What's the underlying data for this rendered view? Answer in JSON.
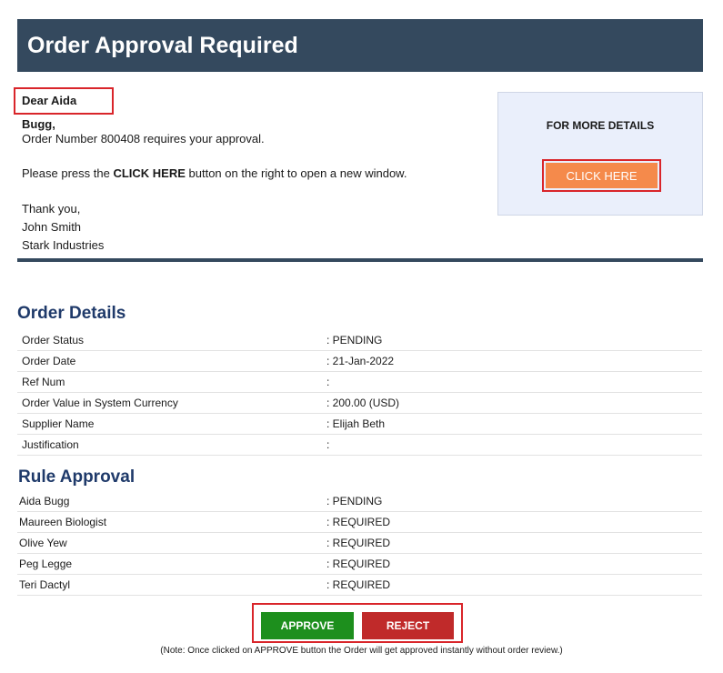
{
  "header": {
    "title": "Order Approval Required"
  },
  "greeting": "Dear Aida Bugg,",
  "intro": {
    "approval_line": "Order Number 800408 requires your approval.",
    "press_prefix": "Please press the ",
    "press_bold": "CLICK HERE",
    "press_suffix": " button on the right to open a new window.",
    "thanks": "Thank you,",
    "signer_name": "John Smith",
    "signer_company": "Stark Industries"
  },
  "details_box": {
    "title": "FOR MORE DETAILS",
    "button_label": "CLICK HERE"
  },
  "colors": {
    "header_bg": "#34495e",
    "section_title": "#1f3a6a",
    "click_here": "#f58a4b",
    "approve": "#1d8f1d",
    "reject": "#c02a2a",
    "highlight_frame": "#d9252a"
  },
  "order_details": {
    "title": "Order Details",
    "rows": [
      {
        "label": "Order Status",
        "value": ": PENDING"
      },
      {
        "label": "Order Date",
        "value": ": 21-Jan-2022"
      },
      {
        "label": "Ref Num",
        "value": ":"
      },
      {
        "label": "Order Value in System Currency",
        "value": ": 200.00 (USD)"
      },
      {
        "label": "Supplier Name",
        "value": ": Elijah Beth"
      },
      {
        "label": "Justification",
        "value": ":"
      }
    ]
  },
  "rule_approval": {
    "title": "Rule Approval",
    "rows": [
      {
        "label": "Aida Bugg",
        "value": ": PENDING"
      },
      {
        "label": "Maureen Biologist",
        "value": ": REQUIRED"
      },
      {
        "label": "Olive Yew",
        "value": ": REQUIRED"
      },
      {
        "label": "Peg Legge",
        "value": ": REQUIRED"
      },
      {
        "label": "Teri Dactyl",
        "value": ": REQUIRED"
      }
    ]
  },
  "actions": {
    "approve_label": "APPROVE",
    "reject_label": "REJECT",
    "note": "(Note: Once clicked on APPROVE button the Order will get approved instantly without order review.)"
  }
}
